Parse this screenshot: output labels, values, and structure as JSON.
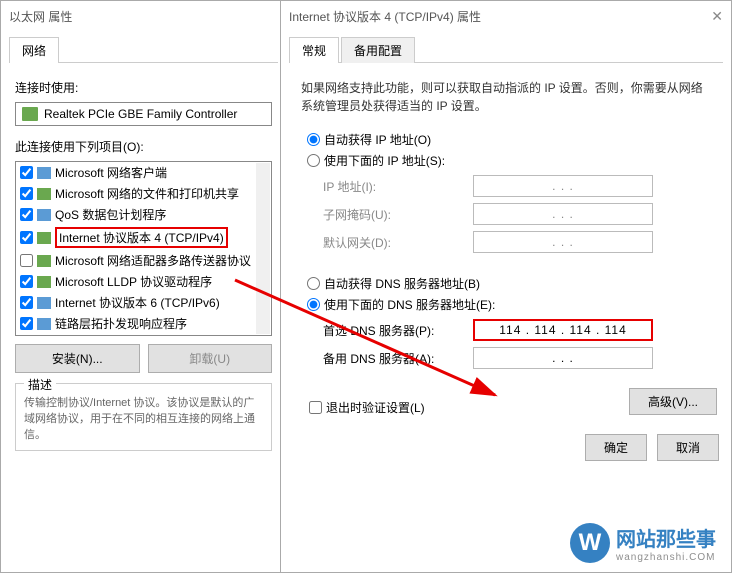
{
  "left": {
    "title": "以太网 属性",
    "tab": "网络",
    "connect_label": "连接时使用:",
    "nic": "Realtek PCIe GBE Family Controller",
    "items_label": "此连接使用下列项目(O):",
    "items": [
      {
        "checked": true,
        "label": "Microsoft 网络客户端"
      },
      {
        "checked": true,
        "label": "Microsoft 网络的文件和打印机共享"
      },
      {
        "checked": true,
        "label": "QoS 数据包计划程序"
      },
      {
        "checked": true,
        "label": "Internet 协议版本 4 (TCP/IPv4)",
        "hl": true
      },
      {
        "checked": false,
        "label": "Microsoft 网络适配器多路传送器协议"
      },
      {
        "checked": true,
        "label": "Microsoft LLDP 协议驱动程序"
      },
      {
        "checked": true,
        "label": "Internet 协议版本 6 (TCP/IPv6)"
      },
      {
        "checked": true,
        "label": "链路层拓扑发现响应程序"
      }
    ],
    "install_btn": "安装(N)...",
    "uninstall_btn": "卸载(U)",
    "desc_title": "描述",
    "desc_text": "传输控制协议/Internet 协议。该协议是默认的广域网络协议，用于在不同的相互连接的网络上通信。"
  },
  "right": {
    "title": "Internet 协议版本 4 (TCP/IPv4) 属性",
    "tabs": [
      "常规",
      "备用配置"
    ],
    "help": "如果网络支持此功能，则可以获取自动指派的 IP 设置。否则，你需要从网络系统管理员处获得适当的 IP 设置。",
    "auto_ip": "自动获得 IP 地址(O)",
    "manual_ip": "使用下面的 IP 地址(S):",
    "ip_label": "IP 地址(I):",
    "mask_label": "子网掩码(U):",
    "gw_label": "默认网关(D):",
    "auto_dns": "自动获得 DNS 服务器地址(B)",
    "manual_dns": "使用下面的 DNS 服务器地址(E):",
    "dns1_label": "首选 DNS 服务器(P):",
    "dns1_value": "114 . 114 . 114 . 114",
    "dns2_label": "备用 DNS 服务器(A):",
    "dns2_value": ".       .       .",
    "validate": "退出时验证设置(L)",
    "advanced": "高级(V)...",
    "ok": "确定",
    "cancel": "取消",
    "empty_ip": ".       .       ."
  },
  "watermark": {
    "brand": "网站那些事",
    "sub": "wangzhanshi.COM",
    "logo": "W"
  }
}
